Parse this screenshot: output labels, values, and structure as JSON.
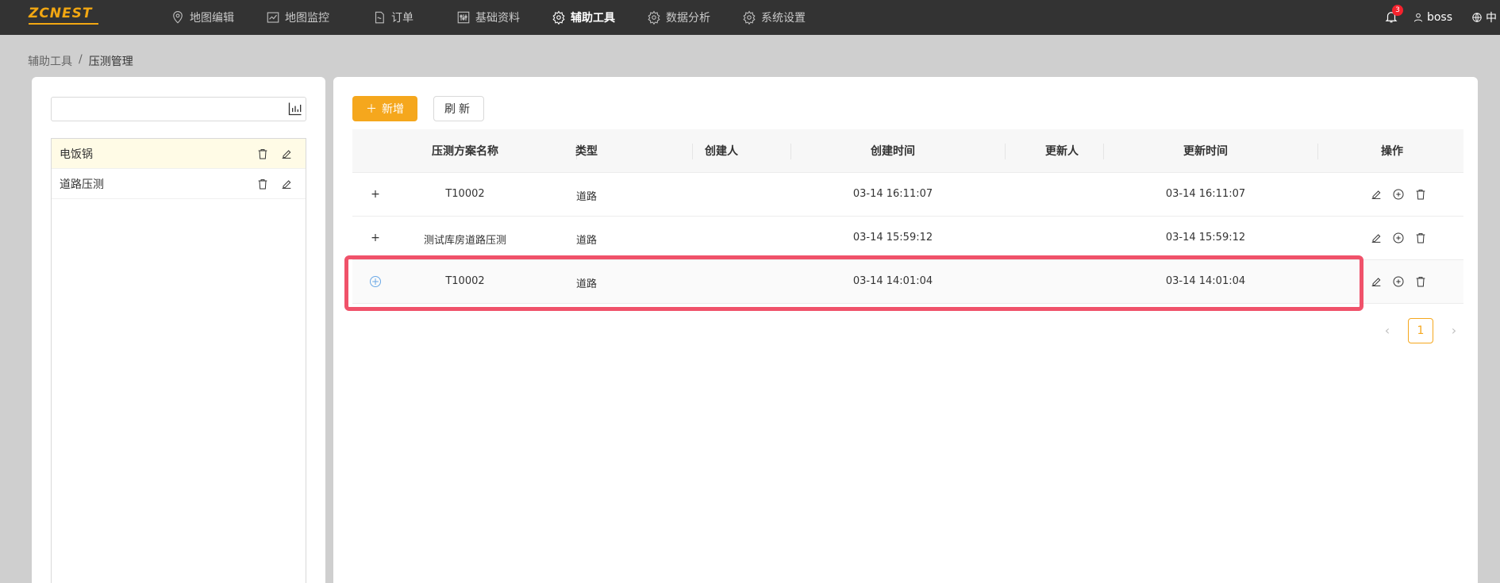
{
  "brand": {
    "logo_text": "ZCNEST",
    "accent": "#f5a71d"
  },
  "nav": {
    "items": [
      {
        "label": "地图编辑",
        "icon": "map-pin-icon"
      },
      {
        "label": "地图监控",
        "icon": "line-chart-icon"
      },
      {
        "label": "订单",
        "icon": "document-icon"
      },
      {
        "label": "基础资料",
        "icon": "sliders-icon"
      },
      {
        "label": "辅助工具",
        "icon": "gear-icon",
        "active": true
      },
      {
        "label": "数据分析",
        "icon": "gear-icon"
      },
      {
        "label": "系统设置",
        "icon": "gear-icon"
      }
    ],
    "notifications": "3",
    "user": "boss",
    "language": "中"
  },
  "breadcrumb": {
    "parent": "辅助工具",
    "separator": "/",
    "current": "压测管理"
  },
  "left": {
    "search_value": "",
    "items": [
      {
        "label": "电饭锅",
        "selected": true
      },
      {
        "label": "道路压测",
        "selected": false
      }
    ]
  },
  "toolbar": {
    "add_label": "新增",
    "refresh_label": "刷新"
  },
  "table": {
    "columns": [
      "压测方案名称",
      "类型",
      "创建人",
      "创建时间",
      "更新人",
      "更新时间",
      "操作"
    ],
    "rows": [
      {
        "name": "T10002",
        "type": "道路",
        "creator": "",
        "created": "03-14 16:11:07",
        "updater": "",
        "updated": "03-14 16:11:07"
      },
      {
        "name": "测试库房道路压测",
        "type": "道路",
        "creator": "",
        "created": "03-14 15:59:12",
        "updater": "",
        "updated": "03-14 15:59:12"
      },
      {
        "name": "T10002",
        "type": "道路",
        "creator": "",
        "created": "03-14 14:01:04",
        "updater": "",
        "updated": "03-14 14:01:04"
      }
    ]
  },
  "pagination": {
    "current": "1",
    "prev": "‹",
    "next": "›"
  }
}
